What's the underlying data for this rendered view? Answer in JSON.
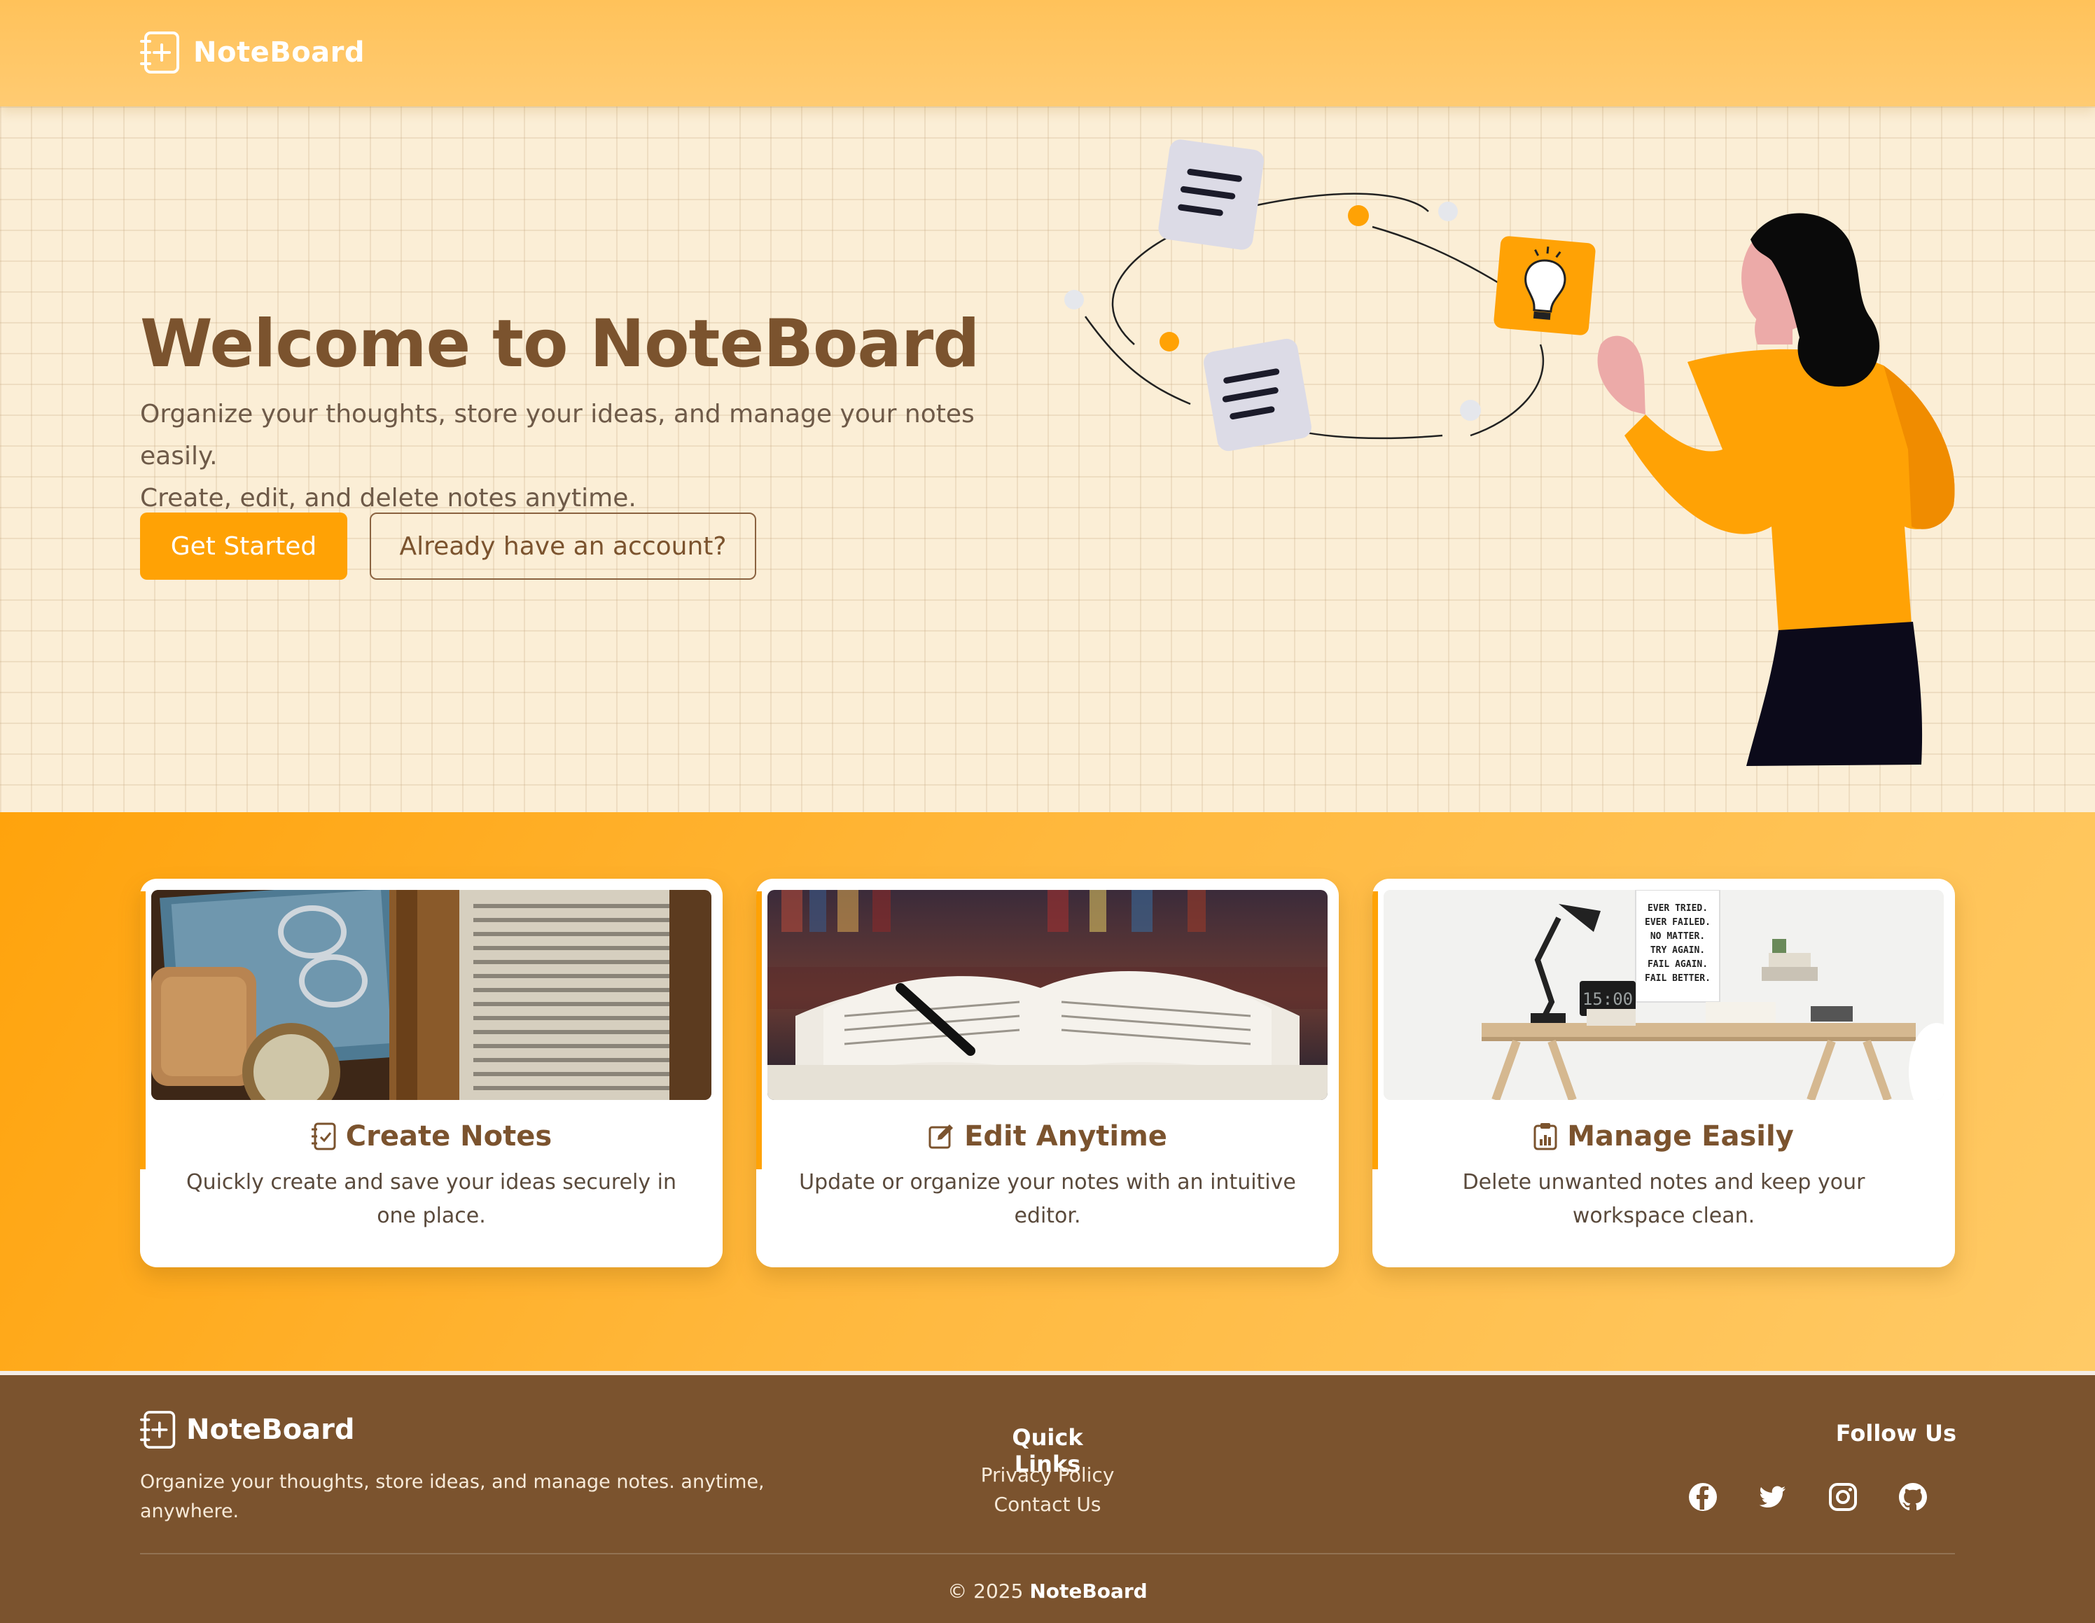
{
  "header": {
    "brand": "NoteBoard",
    "icon": "notebook-plus-icon"
  },
  "hero": {
    "title": "Welcome to NoteBoard",
    "subtitle_line1": "Organize your thoughts, store your ideas, and manage your notes easily.",
    "subtitle_line2": "Create, edit, and delete notes anytime.",
    "primary_button": "Get Started",
    "secondary_button": "Already have an account?"
  },
  "features": [
    {
      "title": "Create Notes",
      "description": "Quickly create and save your ideas securely in one place.",
      "icon": "checklist-icon"
    },
    {
      "title": "Edit Anytime",
      "description": "Update or organize your notes with an intuitive editor.",
      "icon": "edit-icon"
    },
    {
      "title": "Manage Easily",
      "description": "Delete unwanted notes and keep your workspace clean.",
      "icon": "clipboard-chart-icon"
    }
  ],
  "poster_lines": [
    "EVER TRIED.",
    "EVER FAILED.",
    "NO MATTER.",
    "TRY AGAIN.",
    "FAIL AGAIN.",
    "FAIL BETTER."
  ],
  "clock_text": "15:00",
  "footer": {
    "brand": "NoteBoard",
    "description": "Organize your thoughts, store ideas, and manage notes. anytime, anywhere.",
    "quick_links_title": "Quick Links",
    "quick_links": [
      "Privacy Policy",
      "Contact Us"
    ],
    "follow_title": "Follow Us",
    "socials": [
      "facebook-icon",
      "twitter-icon",
      "instagram-icon",
      "github-icon"
    ],
    "copyright_prefix": "© 2025",
    "copyright_brand": "NoteBoard"
  },
  "colors": {
    "accent": "#ffa205",
    "brown": "#7b532e",
    "hero_bg": "#fbeed6"
  }
}
